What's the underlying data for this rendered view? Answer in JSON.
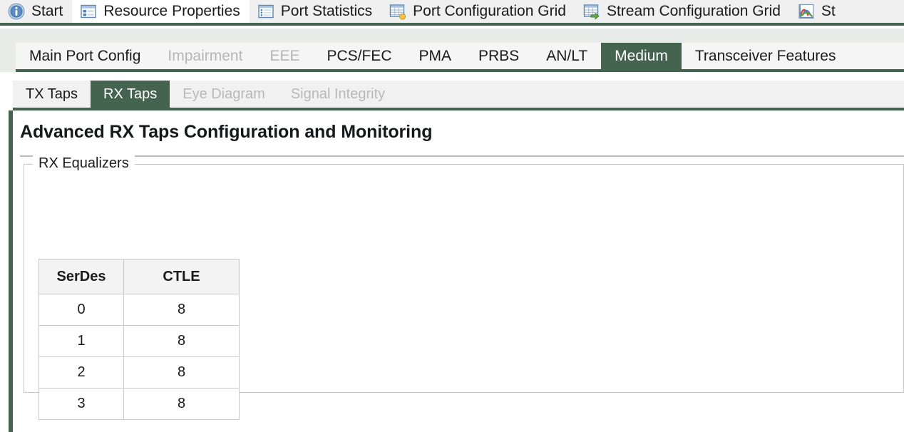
{
  "doc_tabs": [
    {
      "label": "Start",
      "icon": "info-circle-icon",
      "active": false
    },
    {
      "label": "Resource Properties",
      "icon": "properties-panel-icon",
      "active": true
    },
    {
      "label": "Port Statistics",
      "icon": "list-view-icon",
      "active": false
    },
    {
      "label": "Port Configuration Grid",
      "icon": "grid-gold-badge-icon",
      "active": false
    },
    {
      "label": "Stream Configuration Grid",
      "icon": "grid-green-arrow-icon",
      "active": false
    },
    {
      "label": "St",
      "icon": "line-chart-icon",
      "active": false
    }
  ],
  "section_tabs": [
    {
      "label": "Main Port Config",
      "state": "normal"
    },
    {
      "label": "Impairment",
      "state": "disabled"
    },
    {
      "label": "EEE",
      "state": "disabled"
    },
    {
      "label": "PCS/FEC",
      "state": "normal"
    },
    {
      "label": "PMA",
      "state": "normal"
    },
    {
      "label": "PRBS",
      "state": "normal"
    },
    {
      "label": "AN/LT",
      "state": "normal"
    },
    {
      "label": "Medium",
      "state": "active"
    },
    {
      "label": "Transceiver Features",
      "state": "normal"
    }
  ],
  "sub_tabs": [
    {
      "label": "TX Taps",
      "state": "normal"
    },
    {
      "label": "RX Taps",
      "state": "active"
    },
    {
      "label": "Eye Diagram",
      "state": "disabled"
    },
    {
      "label": "Signal Integrity",
      "state": "disabled"
    }
  ],
  "page": {
    "title": "Advanced RX Taps Configuration and Monitoring"
  },
  "group": {
    "legend": "RX Equalizers"
  },
  "table": {
    "columns": [
      "SerDes",
      "CTLE"
    ],
    "rows": [
      [
        "0",
        "8"
      ],
      [
        "1",
        "8"
      ],
      [
        "2",
        "8"
      ],
      [
        "3",
        "8"
      ]
    ]
  },
  "colors": {
    "accent_green": "#456450",
    "tabbar_bg": "#f0f0f0",
    "row2_bg": "#e8ece9",
    "disabled_text": "#b6b6b6"
  }
}
